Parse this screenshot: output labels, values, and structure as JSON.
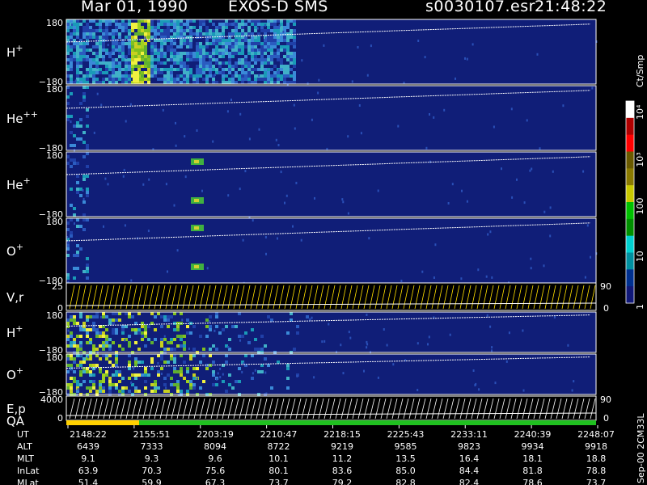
{
  "header": {
    "date": "Mar 01, 1990",
    "instrument": "EXOS-D SMS",
    "file": "s0030107.esr",
    "time": "21:48:22"
  },
  "chart_data": {
    "type": "heatmap",
    "panels": [
      {
        "label": "H",
        "sup": "+",
        "ytop": "180",
        "ybot": "−180",
        "kind": "spec"
      },
      {
        "label": "He",
        "sup": "++",
        "ytop": "180",
        "ybot": "−180",
        "kind": "spec"
      },
      {
        "label": "He",
        "sup": "+",
        "ytop": "180",
        "ybot": "−180",
        "kind": "spec"
      },
      {
        "label": "O",
        "sup": "+",
        "ytop": "180",
        "ybot": "−180",
        "kind": "spec"
      },
      {
        "label": "V,r",
        "sup": "",
        "ytop": "25",
        "ybot": "0",
        "right_top": "90",
        "right_bot": "0",
        "kind": "line"
      },
      {
        "label": "H",
        "sup": "+",
        "ytop": "180",
        "ybot": "−180",
        "kind": "spec"
      },
      {
        "label": "O",
        "sup": "+",
        "ytop": "180",
        "ybot": "−180",
        "kind": "spec"
      },
      {
        "label": "E,p",
        "sup": "",
        "ytop": "4000",
        "ybot": "0",
        "right_top": "90",
        "right_bot": "0",
        "kind": "line"
      }
    ],
    "qa_label": "QA",
    "colorbar": {
      "unit": "Ct/Smp",
      "ticks": [
        "10⁴",
        "10³",
        "100",
        "10",
        "1"
      ],
      "colors": [
        "#ffffff",
        "#b00000",
        "#ff0000",
        "#6a5a00",
        "#8a7a00",
        "#c8c800",
        "#00c000",
        "#009000",
        "#00d0d0",
        "#0090a0",
        "#003090",
        "#101878"
      ]
    },
    "footer_rows": [
      {
        "label": "UT",
        "values": [
          "2148:22",
          "2155:51",
          "2203:19",
          "2210:47",
          "2218:15",
          "2225:43",
          "2233:11",
          "2240:39",
          "2248:07"
        ]
      },
      {
        "label": "ALT",
        "values": [
          "6439",
          "7333",
          "8094",
          "8722",
          "9219",
          "9585",
          "9823",
          "9934",
          "9918"
        ]
      },
      {
        "label": "MLT",
        "values": [
          "9.1",
          "9.3",
          "9.6",
          "10.1",
          "11.2",
          "13.5",
          "16.4",
          "18.1",
          "18.8"
        ]
      },
      {
        "label": "InLat",
        "values": [
          "63.9",
          "70.3",
          "75.6",
          "80.1",
          "83.6",
          "85.0",
          "84.4",
          "81.8",
          "78.8"
        ]
      },
      {
        "label": "MLat",
        "values": [
          "51.4",
          "59.9",
          "67.3",
          "73.7",
          "79.2",
          "82.8",
          "82.4",
          "78.6",
          "73.7"
        ]
      }
    ],
    "side_note": "Sep-00 2CM33L"
  }
}
